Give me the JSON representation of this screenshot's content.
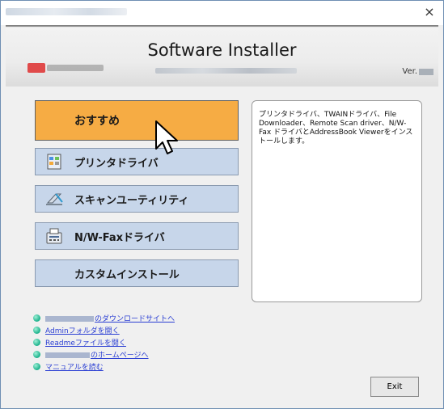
{
  "window": {
    "close_glyph": "×"
  },
  "header": {
    "title": "Software Installer",
    "version_label": "Ver."
  },
  "menu": {
    "items": [
      {
        "label": "おすすめ",
        "icon": "none"
      },
      {
        "label": "プリンタドライバ",
        "icon": "printer-icon"
      },
      {
        "label": "スキャンユーティリティ",
        "icon": "scanner-icon"
      },
      {
        "label": "N/W-Faxドライバ",
        "icon": "fax-icon"
      },
      {
        "label": "カスタムインストール",
        "icon": "none"
      }
    ]
  },
  "description": {
    "text": "プリンタドライバ、TWAINドライバ、File Downloader、Remote Scan driver、N/W-Fax ドライバとAddressBook Viewerをインストールします。"
  },
  "links": {
    "items": [
      {
        "label": "のダウンロードサイトへ"
      },
      {
        "label": "Adminフォルダを開く"
      },
      {
        "label": "Readmeファイルを開く"
      },
      {
        "label": "のホームページへ"
      },
      {
        "label": "マニュアルを読む"
      }
    ]
  },
  "footer": {
    "exit_label": "Exit"
  },
  "colors": {
    "active_button": "#f6ac44",
    "menu_button": "#c7d6ea",
    "link": "#2b3fd3",
    "link_dot": "#19b08a"
  }
}
